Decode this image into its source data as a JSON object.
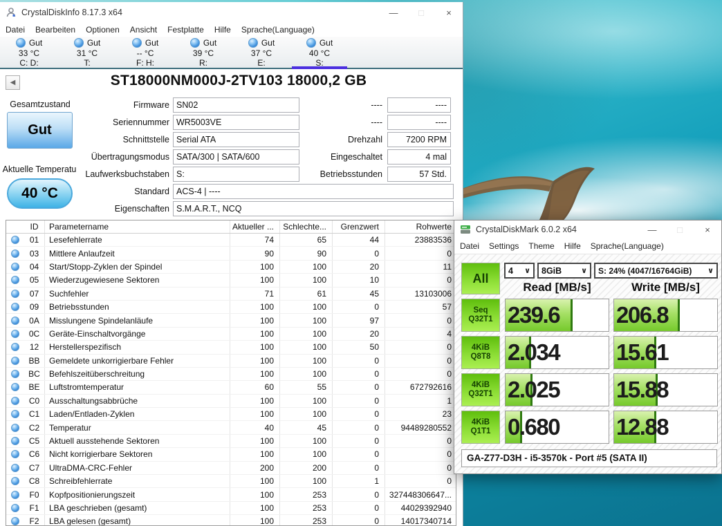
{
  "icons": {
    "cdi_app_icon": "person-icon",
    "cdm_app_icon": "disk-icon",
    "minimize_glyph": "—",
    "maximize_glyph": "□",
    "close_glyph": "×",
    "back_glyph": "◀",
    "combo_chevron_glyph": "∨"
  },
  "colors": {
    "tab_underline": "#4b2fe0",
    "health_button_blue": "#5aa8e7",
    "temp_pill_blue": "#3fb3e6",
    "cdm_green_fill": "#76c92c",
    "cdm_green_edge": "#2f7a10",
    "wallpaper_teal": "#17a2bd"
  },
  "cdi": {
    "title": "CrystalDiskInfo 8.17.3 x64",
    "menu": [
      "Datei",
      "Bearbeiten",
      "Optionen",
      "Ansicht",
      "Festplatte",
      "Hilfe",
      "Sprache(Language)"
    ],
    "tabs": [
      {
        "status": "Gut",
        "temp": "33 °C",
        "letters": "C: D:",
        "selected": false
      },
      {
        "status": "Gut",
        "temp": "31 °C",
        "letters": "T:",
        "selected": false
      },
      {
        "status": "Gut",
        "temp": "-- °C",
        "letters": "F: H:",
        "selected": false
      },
      {
        "status": "Gut",
        "temp": "39 °C",
        "letters": "R:",
        "selected": false
      },
      {
        "status": "Gut",
        "temp": "37 °C",
        "letters": "E:",
        "selected": false
      },
      {
        "status": "Gut",
        "temp": "40 °C",
        "letters": "S:",
        "selected": true
      }
    ],
    "model": "ST18000NM000J-2TV103 18000,2 GB",
    "health_label": "Gesamtzustand",
    "health_value": "Gut",
    "temp_label": "Aktuelle Temperatu",
    "temp_value": "40 °C",
    "fields_left": [
      {
        "label": "Firmware",
        "value": "SN02",
        "wide": false
      },
      {
        "label": "Seriennummer",
        "value": "WR5003VE",
        "wide": false
      },
      {
        "label": "Schnittstelle",
        "value": "Serial ATA",
        "wide": false
      },
      {
        "label": "Übertragungsmodus",
        "value": "SATA/300 | SATA/600",
        "wide": false
      },
      {
        "label": "Laufwerksbuchstaben",
        "value": "S:",
        "wide": false
      },
      {
        "label": "Standard",
        "value": "ACS-4 | ----",
        "wide": true
      },
      {
        "label": "Eigenschaften",
        "value": "S.M.A.R.T., NCQ",
        "wide": true
      }
    ],
    "fields_right": [
      {
        "label": "----",
        "value": "----"
      },
      {
        "label": "----",
        "value": "----"
      },
      {
        "label": "Drehzahl",
        "value": "7200 RPM"
      },
      {
        "label": "Eingeschaltet",
        "value": "4 mal"
      },
      {
        "label": "Betriebsstunden",
        "value": "57 Std."
      }
    ],
    "table": {
      "headers": [
        "ID",
        "Parametername",
        "Aktueller ...",
        "Schlechte...",
        "Grenzwert",
        "Rohwerte"
      ],
      "rows": [
        [
          "01",
          "Lesefehlerrate",
          "74",
          "65",
          "44",
          "23883536"
        ],
        [
          "03",
          "Mittlere Anlaufzeit",
          "90",
          "90",
          "0",
          "0"
        ],
        [
          "04",
          "Start/Stopp-Zyklen der Spindel",
          "100",
          "100",
          "20",
          "11"
        ],
        [
          "05",
          "Wiederzugewiesene Sektoren",
          "100",
          "100",
          "10",
          "0"
        ],
        [
          "07",
          "Suchfehler",
          "71",
          "61",
          "45",
          "13103006"
        ],
        [
          "09",
          "Betriebsstunden",
          "100",
          "100",
          "0",
          "57"
        ],
        [
          "0A",
          "Misslungene Spindelanläufe",
          "100",
          "100",
          "97",
          "0"
        ],
        [
          "0C",
          "Geräte-Einschaltvorgänge",
          "100",
          "100",
          "20",
          "4"
        ],
        [
          "12",
          "Herstellerspezifisch",
          "100",
          "100",
          "50",
          "0"
        ],
        [
          "BB",
          "Gemeldete unkorrigierbare Fehler",
          "100",
          "100",
          "0",
          "0"
        ],
        [
          "BC",
          "Befehlszeitüberschreitung",
          "100",
          "100",
          "0",
          "0"
        ],
        [
          "BE",
          "Luftstromtemperatur",
          "60",
          "55",
          "0",
          "672792616"
        ],
        [
          "C0",
          "Ausschaltungsabbrüche",
          "100",
          "100",
          "0",
          "1"
        ],
        [
          "C1",
          "Laden/Entladen-Zyklen",
          "100",
          "100",
          "0",
          "23"
        ],
        [
          "C2",
          "Temperatur",
          "40",
          "45",
          "0",
          "94489280552"
        ],
        [
          "C5",
          "Aktuell ausstehende Sektoren",
          "100",
          "100",
          "0",
          "0"
        ],
        [
          "C6",
          "Nicht korrigierbare Sektoren",
          "100",
          "100",
          "0",
          "0"
        ],
        [
          "C7",
          "UltraDMA-CRC-Fehler",
          "200",
          "200",
          "0",
          "0"
        ],
        [
          "C8",
          "Schreibfehlerrate",
          "100",
          "100",
          "1",
          "0"
        ],
        [
          "F0",
          "Kopfpositionierungszeit",
          "100",
          "253",
          "0",
          "327448306647..."
        ],
        [
          "F1",
          "LBA geschrieben (gesamt)",
          "100",
          "253",
          "0",
          "44029392940"
        ],
        [
          "F2",
          "LBA gelesen (gesamt)",
          "100",
          "253",
          "0",
          "14017340714"
        ]
      ]
    }
  },
  "cdm": {
    "title": "CrystalDiskMark 6.0.2 x64",
    "menu": [
      "Datei",
      "Settings",
      "Theme",
      "Hilfe",
      "Sprache(Language)"
    ],
    "all_label": "All",
    "combo_queues": "4",
    "combo_size": "8GiB",
    "combo_target": "S: 24% (4047/16764GiB)",
    "read_header": "Read [MB/s]",
    "write_header": "Write [MB/s]",
    "rows": [
      {
        "label_top": "Seq",
        "label_bottom": "Q32T1",
        "read": "239.6",
        "write": "206.8",
        "read_fill": 65,
        "write_fill": 64
      },
      {
        "label_top": "4KiB",
        "label_bottom": "Q8T8",
        "read": "2.034",
        "write": "15.61",
        "read_fill": 25,
        "write_fill": 41
      },
      {
        "label_top": "4KiB",
        "label_bottom": "Q32T1",
        "read": "2.025",
        "write": "15.88",
        "read_fill": 26,
        "write_fill": 42
      },
      {
        "label_top": "4KiB",
        "label_bottom": "Q1T1",
        "read": "0.680",
        "write": "12.88",
        "read_fill": 16,
        "write_fill": 41
      }
    ],
    "comment": "GA-Z77-D3H - i5-3570k - Port #5 (SATA II)"
  }
}
